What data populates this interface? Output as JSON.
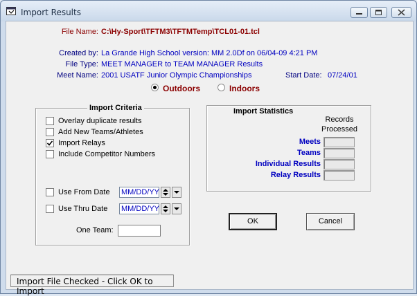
{
  "window": {
    "title": "Import Results"
  },
  "file": {
    "name_label": "File Name:",
    "name_value": "C:\\Hy-Sport\\TFTM3\\TFTMTemp\\TCL01-01.tcl",
    "created_label": "Created by:",
    "created_value": "La Grande High School   version: MM 2.0Df on 06/04-09 4:21 PM",
    "type_label": "File Type:",
    "type_value": "MEET MANAGER to TEAM MANAGER Results",
    "meet_label": "Meet Name:",
    "meet_value": "2001 USATF Junior Olympic Championships",
    "start_label": "Start Date:",
    "start_value": "07/24/01"
  },
  "venue": {
    "outdoors_label": "Outdoors",
    "indoors_label": "Indoors",
    "selected": "Outdoors"
  },
  "criteria": {
    "title": "Import Criteria",
    "options": [
      {
        "label": "Overlay duplicate results",
        "checked": false
      },
      {
        "label": "Add New Teams/Athletes",
        "checked": false
      },
      {
        "label": "Import Relays",
        "checked": true
      },
      {
        "label": "Include Competitor Numbers",
        "checked": false
      }
    ],
    "use_from_label": "Use From Date",
    "use_from_checked": false,
    "from_value": "MM/DD/YY",
    "use_thru_label": "Use Thru Date",
    "use_thru_checked": false,
    "thru_value": "MM/DD/YY",
    "one_team_label": "One Team:",
    "one_team_value": ""
  },
  "statistics": {
    "title": "Import Statistics",
    "records_header_1": "Records",
    "records_header_2": "Processed",
    "rows": [
      {
        "label": "Meets",
        "value": ""
      },
      {
        "label": "Teams",
        "value": ""
      },
      {
        "label": "Individual Results",
        "value": ""
      },
      {
        "label": "Relay Results",
        "value": ""
      }
    ]
  },
  "buttons": {
    "ok": "OK",
    "cancel": "Cancel"
  },
  "status": "Import File Checked - Click OK to Import"
}
